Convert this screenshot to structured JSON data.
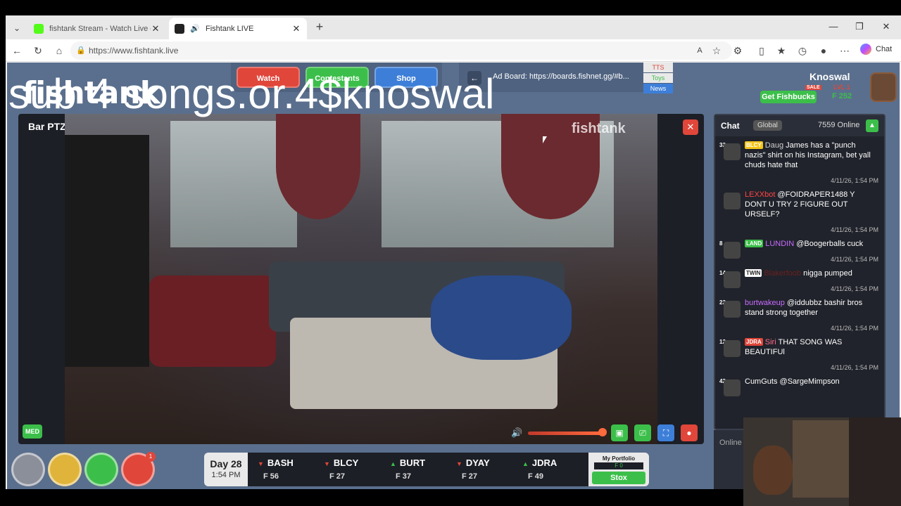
{
  "browser": {
    "tabs": [
      {
        "title": "fishtank Stream - Watch Live on K",
        "active": false
      },
      {
        "title": "Fishtank LIVE",
        "active": true
      }
    ],
    "url": "https://www.fishtank.live",
    "chat_label": "Chat"
  },
  "page": {
    "logo": "fishtank",
    "overlay_text": "sub 4 songs.or.4$knoswal",
    "nav": {
      "watch": "Watch",
      "contestants": "Contestants",
      "shop": "Shop"
    },
    "ad_board": {
      "text": "Ad Board: https://boards.fishnet.gg/#b...",
      "tabs": [
        "TTS",
        "Toys",
        "News"
      ]
    },
    "user": {
      "name": "Knoswal",
      "level": "LVL 1",
      "get_fishbucks": "Get Fishbucks",
      "sale": "SALE",
      "coins": "F 252"
    }
  },
  "player": {
    "camera_name": "Bar PTZ",
    "watermark": "fishtank",
    "quality": "MED",
    "volume": 0.95
  },
  "chat": {
    "title": "Chat",
    "channel": "Global",
    "online": "7559 Online",
    "messages": [
      {
        "level": "33",
        "tag": "BLCY",
        "tag_color": "#f5c518",
        "user": "Daug",
        "user_color": "#cfcfcf",
        "text": "James has a \"punch nazis\" shirt on his Instagram, bet yall chuds hate that",
        "time": "4/11/26, 1:54 PM"
      },
      {
        "level": "",
        "tag": "",
        "tag_color": "",
        "user": "LEXXbot",
        "user_color": "#ff4444",
        "text": "@FOIDRAPER1488 Y DONT U TRY 2 FIGURE OUT URSELF?",
        "time": "4/11/26, 1:54 PM"
      },
      {
        "level": "8",
        "tag": "LAND",
        "tag_color": "#3cbf4a",
        "user": "LUNDIN",
        "user_color": "#c86bff",
        "text": "@Boogerballs cuck",
        "time": "4/11/26, 1:54 PM"
      },
      {
        "level": "14",
        "tag": "TWIN",
        "tag_color": "#ffffff",
        "user": "Blakerfoob",
        "user_color": "#6a2020",
        "text": "nigga pumped",
        "time": "4/11/26, 1:54 PM"
      },
      {
        "level": "23",
        "tag": "",
        "tag_color": "",
        "user": "burtwakeup",
        "user_color": "#c86bff",
        "text": "@iddubbz bashir bros stand strong together",
        "time": "4/11/26, 1:54 PM"
      },
      {
        "level": "12",
        "tag": "JDRA",
        "tag_color": "#e0463a",
        "user": "Siri",
        "user_color": "#ff6a8a",
        "text": "THAT SONG WAS BEAUTIFUl",
        "time": "4/11/26, 1:54 PM"
      },
      {
        "level": "42",
        "tag": "",
        "tag_color": "",
        "user": "CumGuts",
        "user_color": "#ffffff",
        "text": "@SargeMimpson",
        "time": ""
      }
    ],
    "input_placeholder": "Online"
  },
  "ticker": {
    "day": "Day 28",
    "time": "1:54 PM",
    "stocks": [
      {
        "symbol": "BASH",
        "direction": "down",
        "value": "F 56"
      },
      {
        "symbol": "BLCY",
        "direction": "down",
        "value": "F 27"
      },
      {
        "symbol": "BURT",
        "direction": "up",
        "value": "F 37"
      },
      {
        "symbol": "DYAY",
        "direction": "down",
        "value": "F 27"
      },
      {
        "symbol": "JDRA",
        "direction": "up",
        "value": "F 49"
      }
    ],
    "portfolio_label": "My Portfolio",
    "portfolio_value": "F 0",
    "stox": "Stox"
  },
  "bottom_icons": [
    "gear-icon",
    "clapper-icon",
    "trash-icon",
    "hammer-sickle-icon"
  ],
  "notification_count": "1"
}
